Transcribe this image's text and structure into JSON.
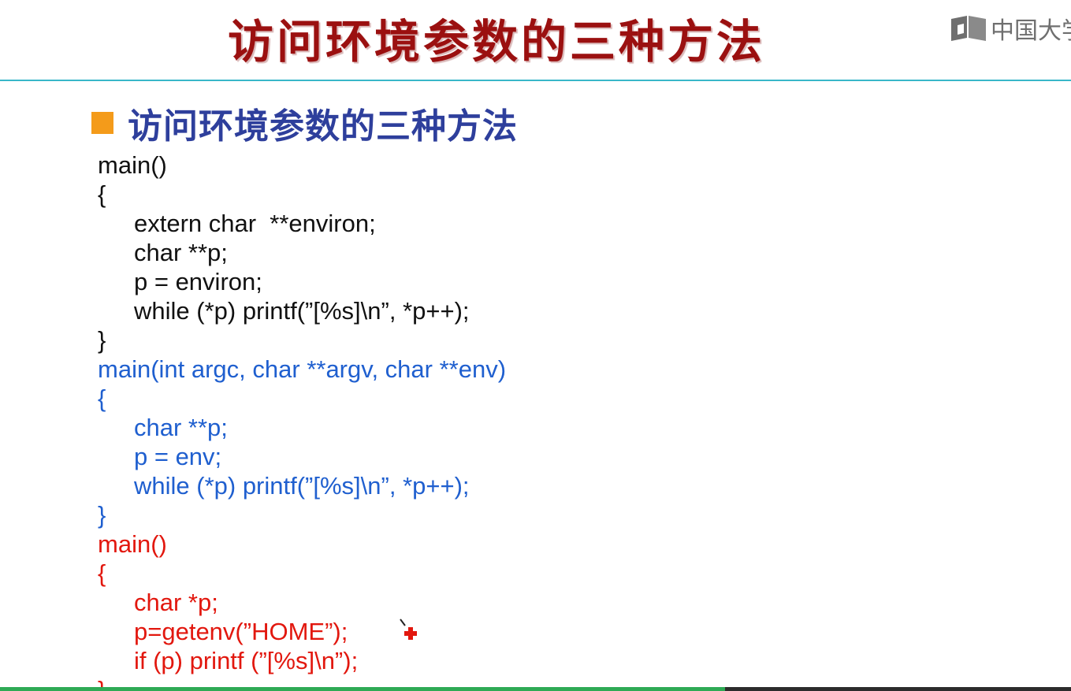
{
  "slide": {
    "title": "访问环境参数的三种方法",
    "heading": "访问环境参数的三种方法",
    "logo_text": "中国大学",
    "colors": {
      "title": "#9b1010",
      "rule": "#39b7c9",
      "bullet": "#f49b1a",
      "heading": "#2e3f9c",
      "code_block_1": "#111111",
      "code_block_2": "#1f5fcf",
      "code_block_3": "#e2170e"
    },
    "code": {
      "block1": [
        "main()",
        "{",
        "extern char  **environ;",
        "char **p;",
        "p = environ;",
        "while (*p) printf(”[%s]\\n”, *p++);",
        "}"
      ],
      "block2": [
        "main(int argc, char **argv, char **env)",
        "{",
        "char **p;",
        "p = env;",
        "while (*p) printf(”[%s]\\n”, *p++);",
        "}"
      ],
      "block3": [
        "main()",
        "{",
        "char *p;",
        "p=getenv(”HOME”);",
        "if (p) printf (”[%s]\\n”);",
        "}"
      ]
    },
    "icons": {
      "logo": "mooc-book-icon",
      "cursor": "pen-cursor-icon"
    }
  }
}
